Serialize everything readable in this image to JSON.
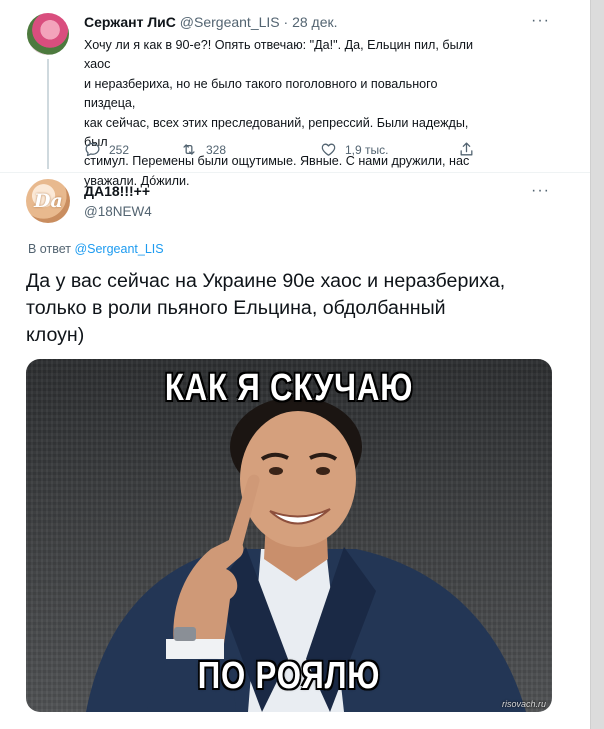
{
  "tweet1": {
    "display_name": "Сержант ЛиС",
    "handle": "@Sergeant_LIS",
    "separator": "·",
    "date": "28 дек.",
    "lines": [
      "Хочу ли я как в 90-е?! Опять отвечаю: \"Да!\". Да, Ельцин пил, были хаос",
      "и неразбериха, но не было такого поголовного и повального пиздеца,",
      "как сейчас, всех этих преследований, репрессий. Были надежды, был",
      "стимул. Перемены были ощутимые. Явные. С нами дружили, нас",
      "уважали. Дóжили."
    ],
    "menu": "···",
    "actions": {
      "replies": "252",
      "retweets": "328",
      "likes": "1,9 тыс."
    }
  },
  "tweet2": {
    "avatar_text": "Da",
    "display_name": "ДА18!!!++",
    "handle": "@18NEW4",
    "menu": "···",
    "reply_prefix": "В ответ ",
    "reply_to": "@Sergeant_LIS",
    "lines": [
      "Да у вас  сейчас на Украине 90е  хаос и неразбериха,",
      "только в роли пьяного Ельцина, обдолбанный",
      "клоун)"
    ],
    "meme": {
      "top_caption": "КАК Я СКУЧАЮ",
      "bottom_caption": "ПО РОЯЛЮ",
      "watermark": "risovach.ru"
    }
  },
  "icons": {
    "reply": "comment-icon",
    "retweet": "retweet-icon",
    "like": "heart-icon",
    "share": "share-icon"
  },
  "colors": {
    "link": "#1d9bf0",
    "muted": "#536471",
    "text": "#0f1419"
  }
}
